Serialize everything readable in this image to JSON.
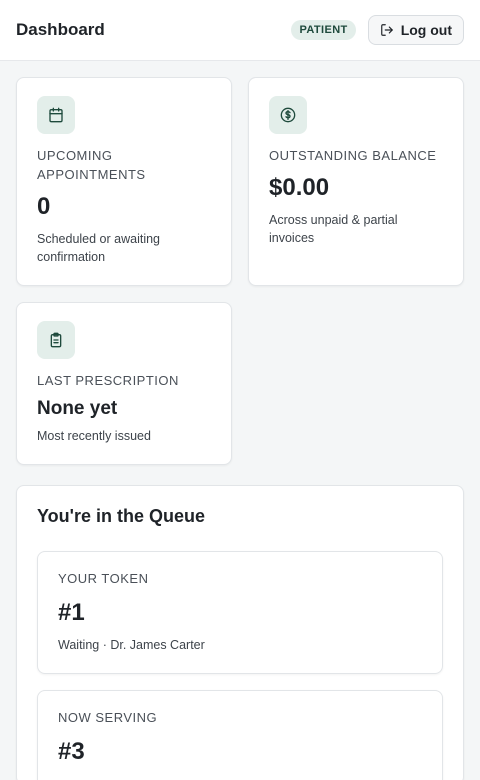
{
  "header": {
    "title": "Dashboard",
    "role_badge": "PATIENT",
    "logout_label": "Log out"
  },
  "stats": [
    {
      "icon": "calendar-icon",
      "label": "UPCOMING APPOINTMENTS",
      "value": "0",
      "desc": "Scheduled or awaiting confirmation"
    },
    {
      "icon": "currency-icon",
      "label": "OUTSTANDING BALANCE",
      "value": "$0.00",
      "desc": "Across unpaid & partial invoices"
    },
    {
      "icon": "clipboard-icon",
      "label": "LAST PRESCRIPTION",
      "value": "None yet",
      "desc": "Most recently issued"
    }
  ],
  "queue": {
    "title": "You're in the Queue",
    "your_token": {
      "label": "YOUR TOKEN",
      "value": "#1",
      "status": "Waiting",
      "doctor": "Dr. James Carter",
      "sub": "Waiting · Dr. James Carter"
    },
    "now_serving": {
      "label": "NOW SERVING",
      "value": "#3"
    }
  },
  "colors": {
    "accent": "#1e4a3c",
    "accent_bg": "#e3eeea",
    "page_bg": "#f4f6f7"
  }
}
